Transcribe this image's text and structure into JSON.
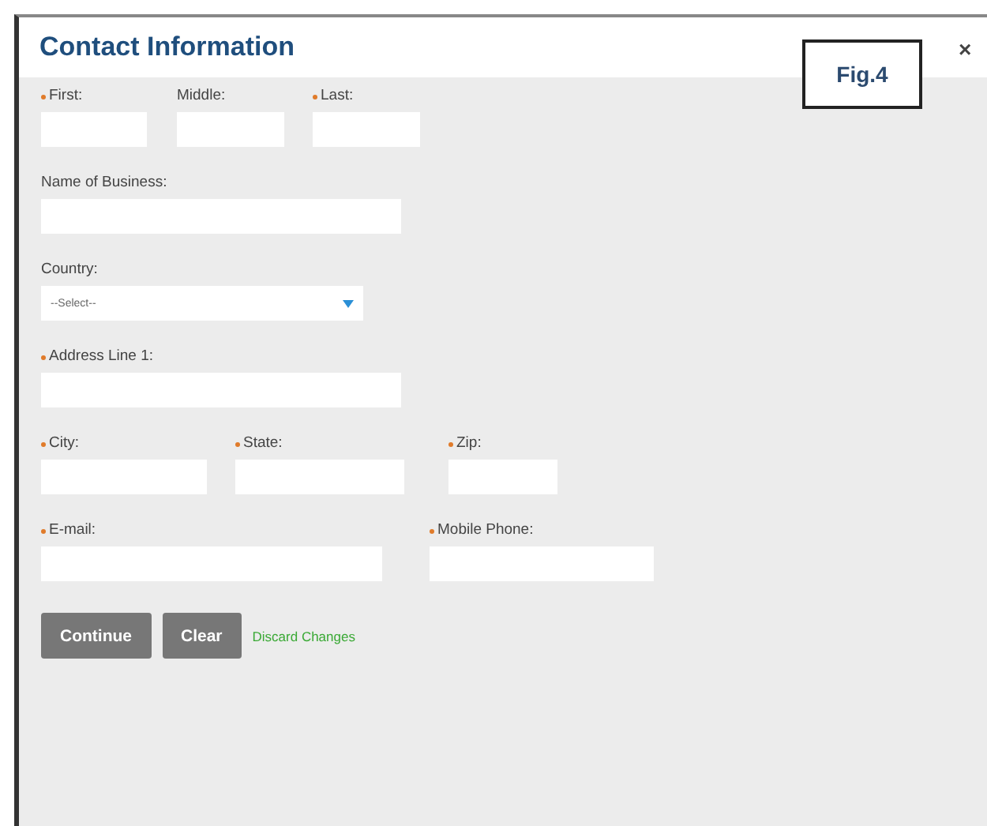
{
  "dialog": {
    "title": "Contact Information",
    "figure_label": "Fig.4",
    "close": "×"
  },
  "rows": [
    {
      "fields": [
        {
          "label": "First:",
          "required": true,
          "kind": "text"
        },
        {
          "label": "Middle:",
          "required": false,
          "kind": "text"
        },
        {
          "label": "Last:",
          "required": true,
          "kind": "text"
        }
      ]
    },
    {
      "fields": [
        {
          "label": "Name of Business:",
          "required": false,
          "kind": "text"
        }
      ]
    },
    {
      "fields": [
        {
          "label": "Country:",
          "required": false,
          "kind": "select",
          "value": "--Select--"
        }
      ]
    },
    {
      "fields": [
        {
          "label": "Address Line 1:",
          "required": true,
          "kind": "text"
        }
      ]
    },
    {
      "fields": [
        {
          "label": "City:",
          "required": true,
          "kind": "text"
        },
        {
          "label": "State:",
          "required": true,
          "kind": "text"
        },
        {
          "label": "Zip:",
          "required": true,
          "kind": "text"
        }
      ]
    },
    {
      "fields": [
        {
          "label": "E-mail:",
          "required": true,
          "kind": "text"
        },
        {
          "label": "Mobile Phone:",
          "required": true,
          "kind": "text"
        }
      ]
    }
  ],
  "actions": {
    "buttons": [
      "Continue",
      "Clear"
    ],
    "link": "Discard Changes"
  }
}
